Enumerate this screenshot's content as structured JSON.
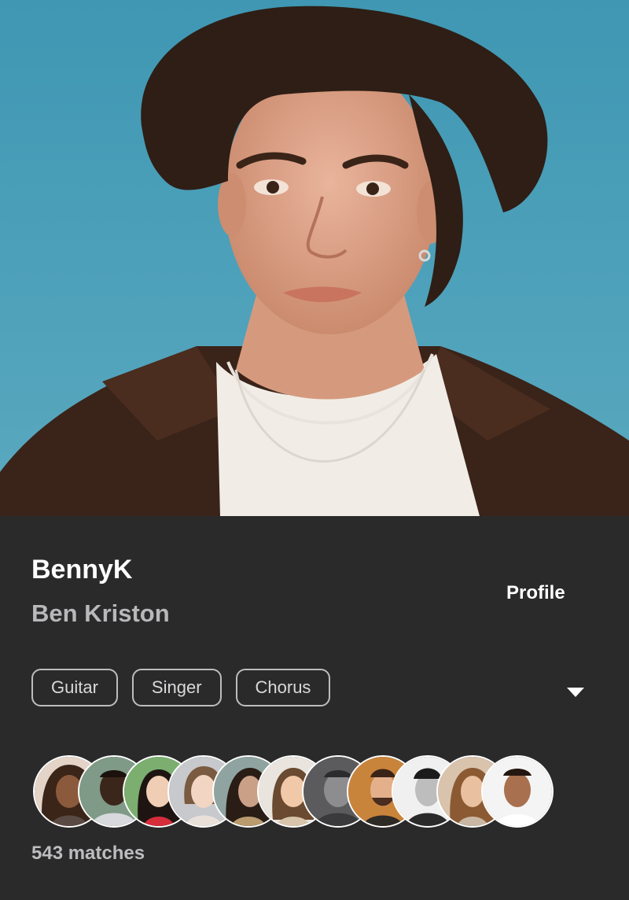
{
  "profile": {
    "username": "BennyK",
    "full_name": "Ben Kriston",
    "profile_link_label": "Profile",
    "tags": [
      "Guitar",
      "Singer",
      "Chorus"
    ],
    "matches_label": "543 matches",
    "expand_icon": "caret-down-icon"
  },
  "colors": {
    "panel_bg": "#2a2a2b",
    "sky": "#4ba0b9",
    "tag_border": "#bdbdbf"
  }
}
